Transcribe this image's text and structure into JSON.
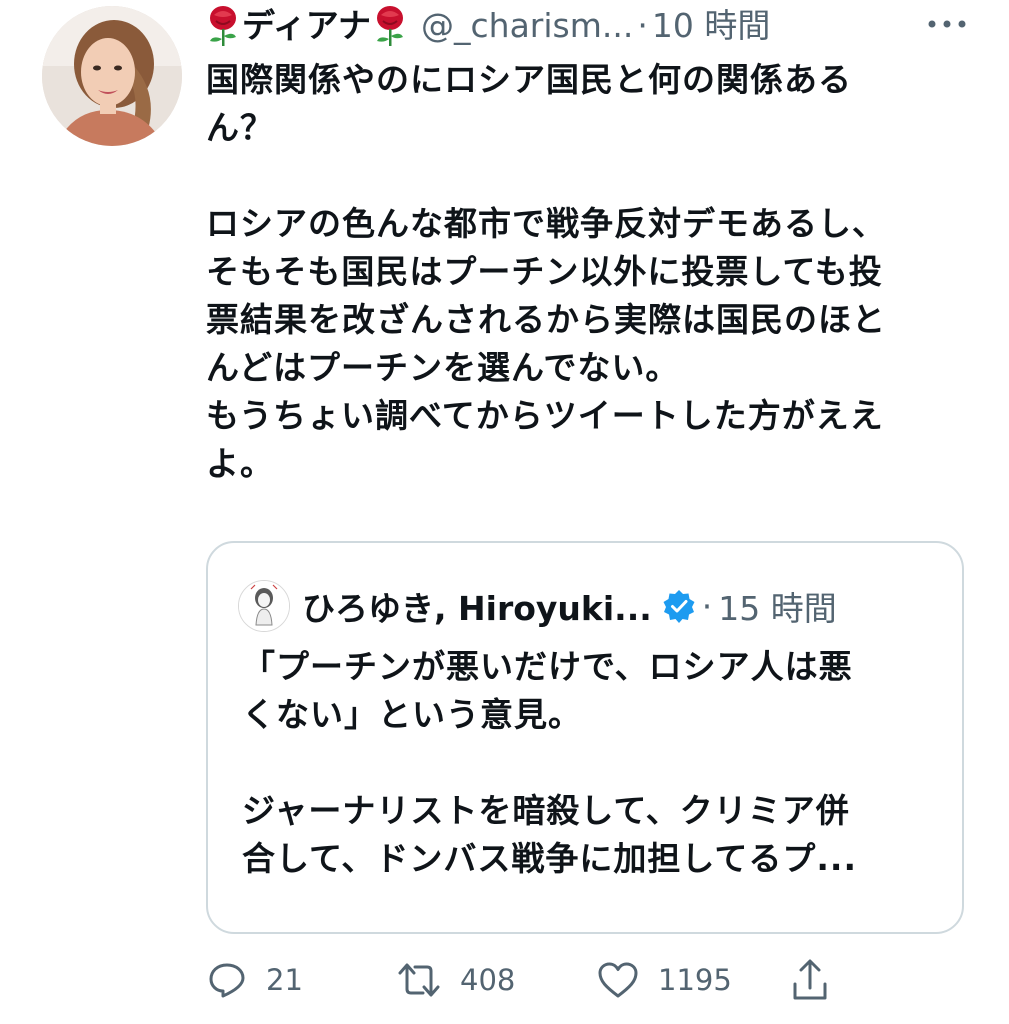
{
  "tweet": {
    "display_name": "ディアナ",
    "name_emoji": "rose-emoji",
    "handle": "@_charism...",
    "separator": "·",
    "time": "10 時間",
    "more_icon": "more-dots-icon",
    "body_paragraphs": [
      "国際関係やのにロシア国民と何の関係あるん？",
      "",
      "ロシアの色んな都市で戦争反対デモあるし、そもそも国民はプーチン以外に投票しても投票結果を改ざんされるから実際は国民のほとんどはプーチンを選んでない。",
      "もうちょい調べてからツイートした方がええよ。"
    ],
    "body_lines": [
      "国際関係やのにロシア国民と何の関係ある",
      "ん？",
      "",
      "ロシアの色んな都市で戦争反対デモあるし、",
      "そもそも国民はプーチン以外に投票しても投",
      "票結果を改ざんされるから実際は国民のほと",
      "んどはプーチンを選んでない。",
      "もうちょい調べてからツイートした方がええ",
      "よ。"
    ]
  },
  "quoted_tweet": {
    "display_name": "ひろゆき, Hiroyuki...",
    "verified_icon": "verified-badge-icon",
    "separator": "·",
    "time": "15 時間",
    "body_lines": [
      "「プーチンが悪いだけで、ロシア人は悪",
      "くない」という意見。",
      "",
      "ジャーナリストを暗殺して、クリミア併",
      "合して、ドンバス戦争に加担してるプ..."
    ]
  },
  "actions": {
    "reply": {
      "icon": "reply-icon",
      "count": "21"
    },
    "retweet": {
      "icon": "retweet-icon",
      "count": "408"
    },
    "like": {
      "icon": "heart-icon",
      "count": "1195"
    },
    "share": {
      "icon": "share-icon"
    }
  },
  "colors": {
    "text": "#0f1419",
    "secondary": "#536471",
    "border": "#cfd9de",
    "verified": "#1d9bf0",
    "rose": "#c8102e"
  }
}
